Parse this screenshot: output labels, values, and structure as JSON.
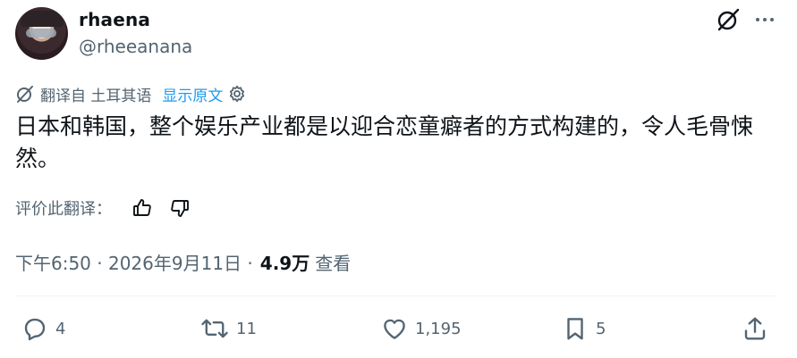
{
  "author": {
    "display_name": "rhaena",
    "handle": "@rheeanana"
  },
  "translation": {
    "translated_from": "翻译自 土耳其语",
    "show_original": "显示原文"
  },
  "tweet": {
    "text": "日本和韩国，整个娱乐产业都是以迎合恋童癖者的方式构建的，令人毛骨悚然。"
  },
  "rate": {
    "label": "评价此翻译："
  },
  "meta": {
    "timestamp": "下午6:50 · 2026年9月11日 ·",
    "views_count": "4.9万",
    "views_label": "查看"
  },
  "actions": {
    "replies": "4",
    "reposts": "11",
    "likes": "1,195",
    "bookmarks": "5"
  },
  "icons": [
    "grok-icon",
    "more-icon",
    "translate-icon",
    "settings-gear-icon",
    "thumbs-up-icon",
    "thumbs-down-icon",
    "reply-icon",
    "repost-icon",
    "like-icon",
    "bookmark-icon",
    "share-icon"
  ],
  "colors": {
    "text": "#0f1419",
    "secondary": "#536471",
    "link": "#1d9bf0",
    "divider": "#eff3f4"
  }
}
